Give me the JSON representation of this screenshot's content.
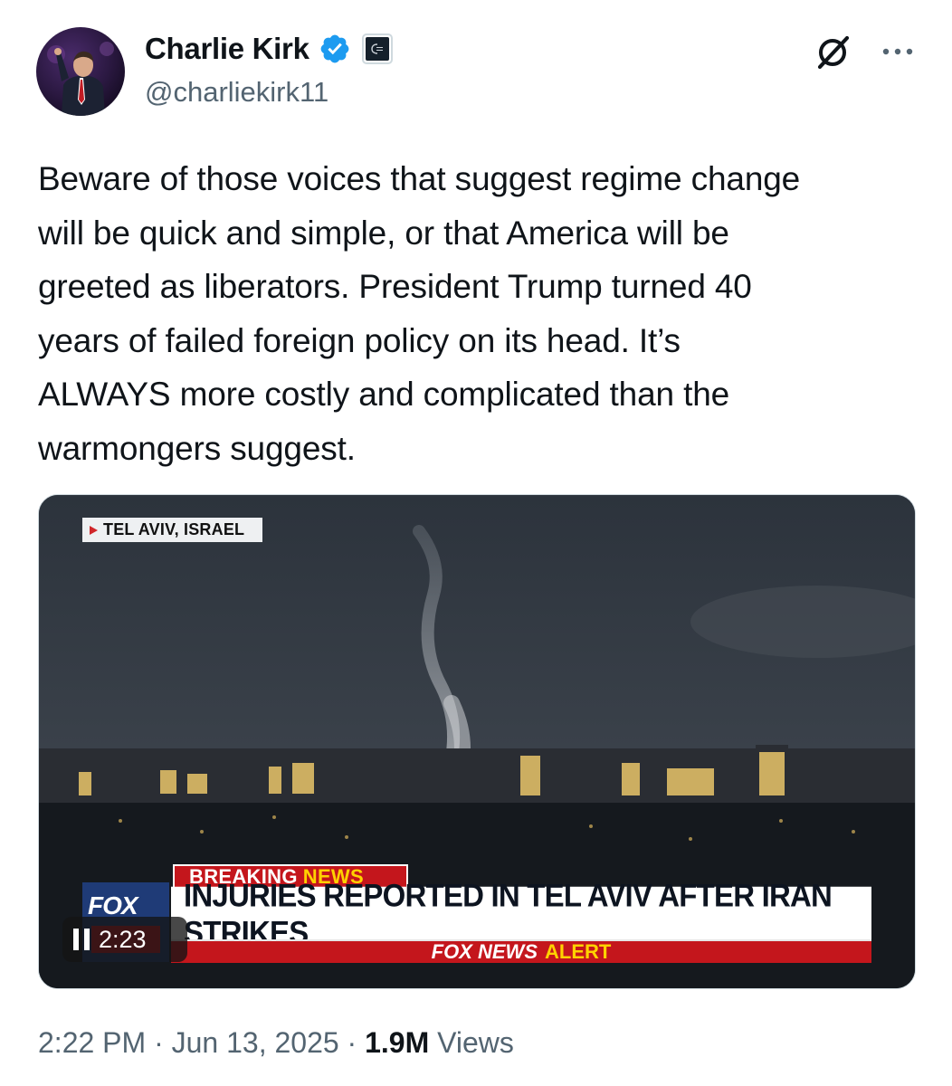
{
  "author": {
    "display_name": "Charlie Kirk",
    "handle": "@charliekirk11",
    "verified": true,
    "verified_color": "#1d9bf0"
  },
  "header_icons": [
    "grok-icon",
    "more-options-icon"
  ],
  "tweet": {
    "text": "Beware of those voices that suggest regime change\nwill be quick and simple, or that America will be\ngreeted as liberators. President Trump turned 40\nyears of failed foreign policy on its head. It’s\nALWAYS more costly and complicated than the\nwarmongers suggest."
  },
  "media": {
    "location_tag": "TEL AVIV, ISRAEL",
    "breaking": "BREAKING",
    "news": "NEWS",
    "headline": "INJURIES REPORTED IN TEL AVIV AFTER IRAN STRIKES",
    "alert_brand": "FOX NEWS",
    "alert_word": "ALERT",
    "fox_logo": "FOX",
    "video_time": "2:23",
    "playing": true
  },
  "meta": {
    "time": "2:22 PM",
    "separator": "·",
    "date": "Jun 13, 2025",
    "views_count": "1.9M",
    "views_label": "Views"
  }
}
